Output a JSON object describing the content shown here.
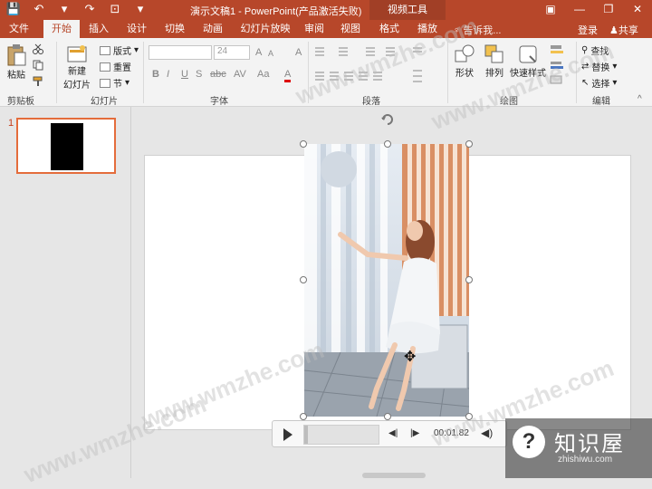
{
  "titlebar": {
    "qat": [
      "💾",
      "↶",
      "▾",
      "↷",
      "⊡",
      "▾"
    ],
    "doc_title": "演示文稿1 - PowerPoint(产品激活失败)",
    "context_tab": "视频工具",
    "window_buttons": [
      "▣",
      "—",
      "❐",
      "✕"
    ]
  },
  "tabs": [
    {
      "label": "文件",
      "active": false
    },
    {
      "label": "开始",
      "active": true
    },
    {
      "label": "插入",
      "active": false
    },
    {
      "label": "设计",
      "active": false
    },
    {
      "label": "切换",
      "active": false
    },
    {
      "label": "动画",
      "active": false
    },
    {
      "label": "幻灯片放映",
      "active": false
    },
    {
      "label": "审阅",
      "active": false
    },
    {
      "label": "视图",
      "active": false
    },
    {
      "label": "格式",
      "active": false
    },
    {
      "label": "播放",
      "active": false
    }
  ],
  "tell_me": "告诉我...",
  "login": "登录",
  "share": "共享",
  "ribbon": {
    "clipboard": {
      "paste": "粘贴",
      "label": "剪贴板"
    },
    "slides": {
      "new_slide": "新建",
      "new_slide2": "幻灯片",
      "layout": "版式",
      "reset": "重置",
      "section": "节",
      "label": "幻灯片"
    },
    "font": {
      "font_size": "24",
      "label": "字体",
      "bold": "B",
      "italic": "I",
      "underline": "U",
      "shadow": "S",
      "strike": "abc",
      "spacing": "AV",
      "case": "Aa",
      "color": "A",
      "grow": "A",
      "shrink": "A",
      "clear": "A"
    },
    "paragraph": {
      "label": "段落"
    },
    "drawing": {
      "shapes": "形状",
      "arrange": "排列",
      "quick_styles": "快速样式",
      "label": "绘图"
    },
    "editing": {
      "find": "查找",
      "replace": "替换",
      "select": "选择",
      "label": "编辑"
    }
  },
  "thumbnails": [
    {
      "number": "1"
    }
  ],
  "player": {
    "time": "00:01.82",
    "progress": 0.05
  },
  "watermarks": [
    "www.wmzhe.com",
    "www.wmzhe.com",
    "www.wmzhe.com",
    "www.wmzhe.com",
    "www.wmzhe.com"
  ],
  "logo": {
    "cn": "知识屋",
    "en": "zhishiwu.com"
  },
  "colors": {
    "accent": "#b7472a",
    "selection": "#e46c3b"
  }
}
